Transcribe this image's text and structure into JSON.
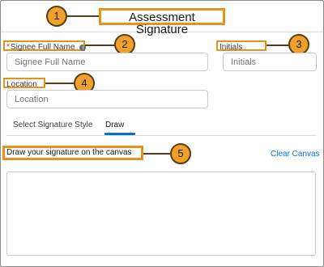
{
  "header": {
    "title": "Assessment Signature"
  },
  "callouts": [
    "1",
    "2",
    "3",
    "4",
    "5"
  ],
  "fields": {
    "signee": {
      "label": "Signee Full Name",
      "required_mark": "*",
      "info_icon": "i",
      "placeholder": "Signee Full Name",
      "value": ""
    },
    "initials": {
      "label": "Initials",
      "placeholder": "Initials",
      "value": ""
    },
    "location": {
      "label": "Location",
      "placeholder": "Location",
      "value": ""
    }
  },
  "tabs": [
    {
      "label": "Select Signature Style",
      "active": false
    },
    {
      "label": "Draw",
      "active": true
    }
  ],
  "draw": {
    "instruction": "Draw your signature on the canvas",
    "clear_label": "Clear Canvas"
  },
  "colors": {
    "accent_blue": "#0176d3",
    "highlight_orange": "#e8921d",
    "callout_fill": "#f0a12c",
    "required_red": "#c23934"
  },
  "icons": [
    "info-icon"
  ]
}
